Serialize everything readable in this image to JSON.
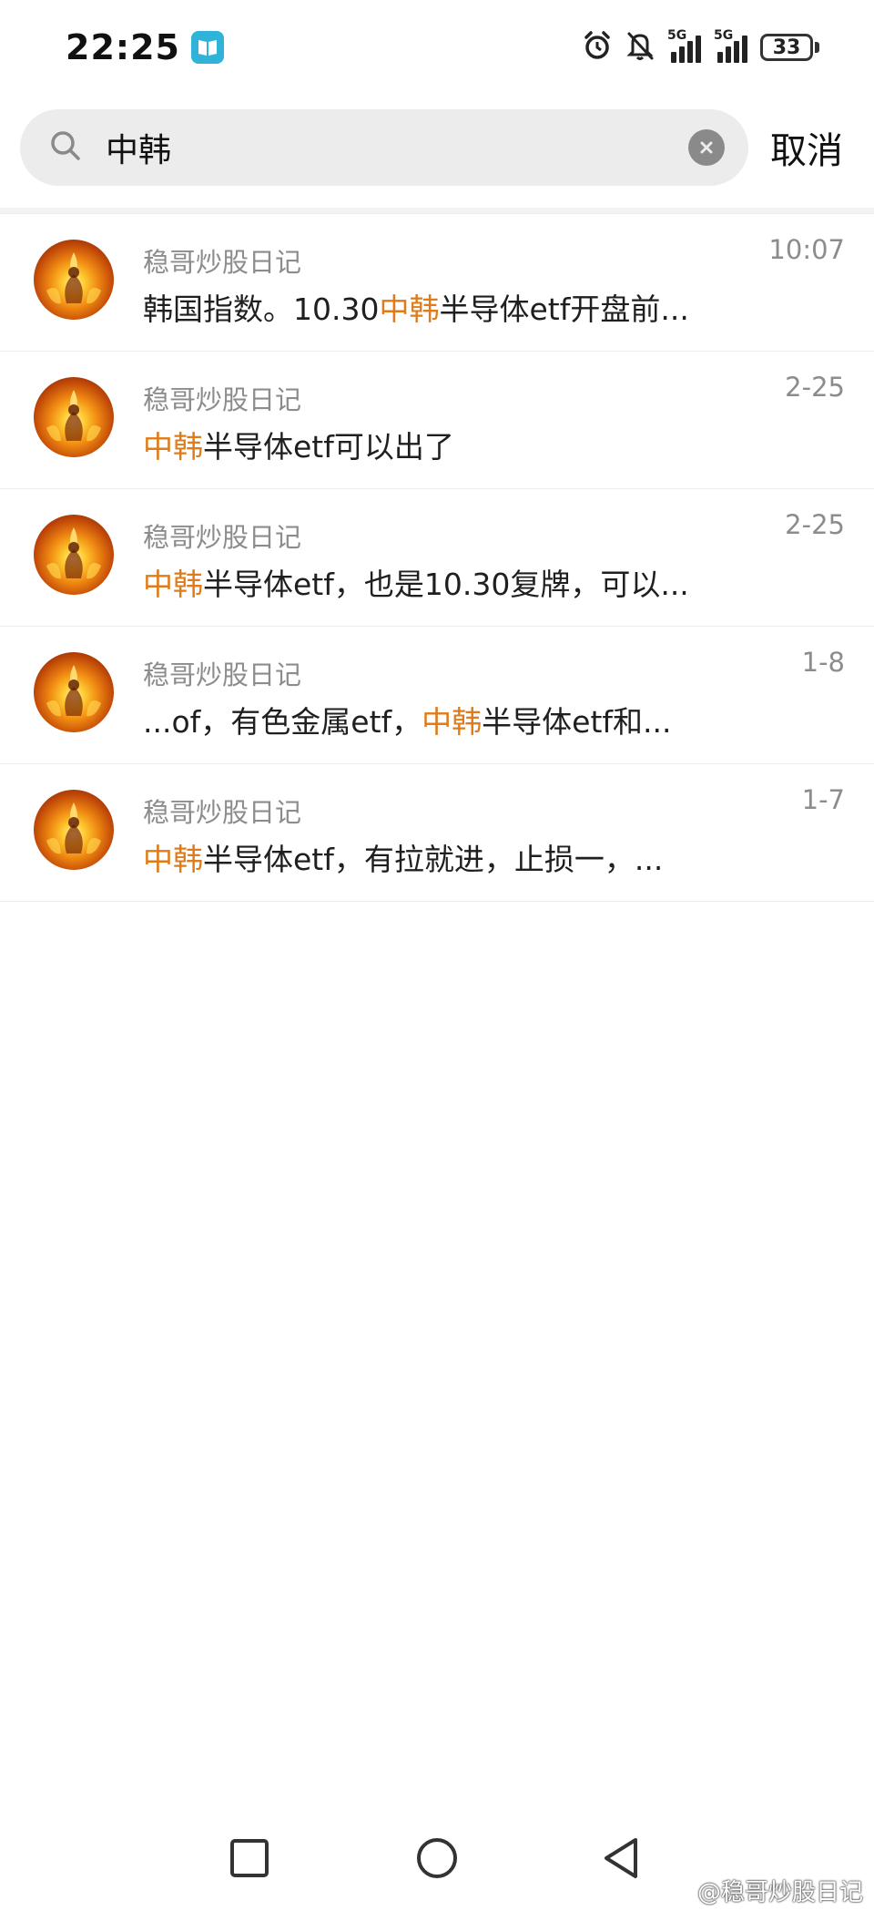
{
  "status_bar": {
    "time": "22:25",
    "network_1": "5G",
    "network_2": "5G",
    "battery": "33"
  },
  "search": {
    "query": "中韩",
    "cancel_label": "取消"
  },
  "results": [
    {
      "name": "稳哥炒股日记",
      "time": "10:07",
      "pre": "韩国指数。10.30",
      "hl": "中韩",
      "post": "半导体etf开盘前..."
    },
    {
      "name": "稳哥炒股日记",
      "time": "2-25",
      "pre": "",
      "hl": "中韩",
      "post": "半导体etf可以出了"
    },
    {
      "name": "稳哥炒股日记",
      "time": "2-25",
      "pre": "",
      "hl": "中韩",
      "post": "半导体etf，也是10.30复牌，可以..."
    },
    {
      "name": "稳哥炒股日记",
      "time": "1-8",
      "pre": "...of，有色金属etf，",
      "hl": "中韩",
      "post": "半导体etf和..."
    },
    {
      "name": "稳哥炒股日记",
      "time": "1-7",
      "pre": "",
      "hl": "中韩",
      "post": "半导体etf，有拉就进，止损一，..."
    }
  ],
  "watermark": "@稳哥炒股日记",
  "colors": {
    "highlight": "#e07b1a",
    "meta_text": "#8c8c8c",
    "search_bg": "#ececec"
  }
}
